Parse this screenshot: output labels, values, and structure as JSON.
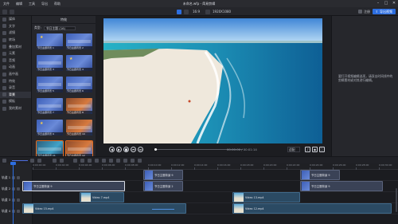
{
  "window": {
    "title": "未命名.wfp - 简易剪辑",
    "menu": [
      "文件",
      "编辑",
      "工具",
      "导出",
      "帮助"
    ],
    "controls": [
      "minimize-icon",
      "maximize-icon",
      "close-icon"
    ]
  },
  "toolbar": {
    "fit_label": "16:9",
    "resolution_label": "1920X1080",
    "register_label": "注册",
    "export_label": "导出视频",
    "accent": "#2d6ee0"
  },
  "sidebar": {
    "items": [
      {
        "label": "媒体",
        "icon": "media-icon"
      },
      {
        "label": "文字",
        "icon": "text-icon"
      },
      {
        "label": "滤镜",
        "icon": "filter-icon"
      },
      {
        "label": "转场",
        "icon": "transition-icon"
      },
      {
        "label": "叠加素材",
        "icon": "overlay-icon"
      },
      {
        "label": "元素",
        "icon": "element-icon"
      },
      {
        "label": "音频",
        "icon": "audio-icon"
      },
      {
        "label": "动画",
        "icon": "animation-icon"
      },
      {
        "label": "画中画",
        "icon": "pip-icon"
      },
      {
        "label": "特效",
        "icon": "effects-icon"
      },
      {
        "label": "录音",
        "icon": "record-icon"
      },
      {
        "label": "背景",
        "icon": "background-icon"
      },
      {
        "label": "模板",
        "icon": "template-icon"
      },
      {
        "label": "我的素材",
        "icon": "my-assets-icon"
      }
    ],
    "active_index": 11
  },
  "library": {
    "header": "特效",
    "filter_label": "类型:",
    "filter_value": "节日主题 (16)",
    "items": [
      "节日主题背景 1",
      "节日主题背景 2",
      "节日主题背景 3",
      "节日主题背景 4",
      "节日主题背景 5",
      "节日主题背景 6",
      "节日主题背景 7",
      "节日主题背景 8",
      "节日主题背景 9",
      "节日主题背景 10",
      "节日主题背景 11",
      "节日主题背景 12"
    ]
  },
  "player": {
    "timecode": "00:00:00 / 00:01:14",
    "zoom": "适配",
    "progress": 0.0
  },
  "properties": {
    "tip": "要打开视频编辑选项，请双击时间线中的剪辑素材或对其进行编辑。"
  },
  "timeline": {
    "ruler": [
      "0:00:00:00",
      "0:00:02:00",
      "0:00:04:00",
      "0:00:06:00",
      "0:00:08:00",
      "0:00:10:00",
      "0:00:12:00",
      "0:00:14:00",
      "0:00:16:00",
      "0:00:18:00",
      "0:00:20:00",
      "0:00:22:00",
      "0:00:24:00",
      "0:00:26:00",
      "0:00:28:00",
      "0:00:30:00"
    ],
    "tracks": [
      {
        "label": "轨道 1"
      },
      {
        "label": "轨道 2"
      },
      {
        "label": "轨道 3"
      },
      {
        "label": "轨道 4"
      }
    ],
    "clips": {
      "fx_a": "节日主题背景 9",
      "fx_b": "节日主题背景 9",
      "fx_c": "节日主题背景 9",
      "fx_d": "节日主题背景 2",
      "fx_e": "节日主题背景 9",
      "vid_a": "Video 7.mp4",
      "vid_b": "Video 13.mp4",
      "vid_c": "Video 15.mp4",
      "vid_d": "Video 12.mp4"
    }
  }
}
